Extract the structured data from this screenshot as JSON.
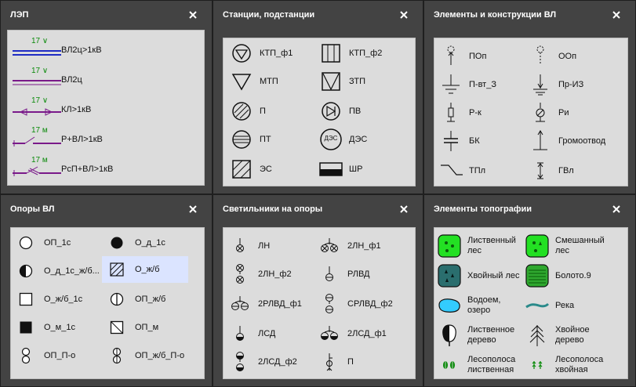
{
  "panels": {
    "lep": {
      "title": "ЛЭП",
      "items": [
        {
          "label": "ВЛ2ц>1кВ",
          "top_label": "17 ∨"
        },
        {
          "label": "ВЛ2ц",
          "top_label": "17 ∨"
        },
        {
          "label": "КЛ>1кВ",
          "top_label": "17 ∨"
        },
        {
          "label": "Р+ВЛ>1кВ",
          "top_label": "17 м"
        },
        {
          "label": "РсП+ВЛ>1кВ",
          "top_label": "17 м"
        }
      ]
    },
    "stations": {
      "title": "Станции, подстанции",
      "items": [
        {
          "label": "КТП_ф1"
        },
        {
          "label": "КТП_ф2"
        },
        {
          "label": "МТП"
        },
        {
          "label": "ЗТП"
        },
        {
          "label": "П"
        },
        {
          "label": "ПВ"
        },
        {
          "label": "ПТ"
        },
        {
          "label": "ДЭС",
          "icon_text": "ДЭС"
        },
        {
          "label": "ЭС"
        },
        {
          "label": "ШР"
        }
      ]
    },
    "elements": {
      "title": "Элементы и конструкции ВЛ",
      "items": [
        {
          "label": "ПОп"
        },
        {
          "label": "ООп"
        },
        {
          "label": "П-вт_З"
        },
        {
          "label": "Пр-ИЗ"
        },
        {
          "label": "Р-к"
        },
        {
          "label": "Ри"
        },
        {
          "label": "БК"
        },
        {
          "label": "Громоотвод"
        },
        {
          "label": "ТПл"
        },
        {
          "label": "ГВл"
        }
      ]
    },
    "supports": {
      "title": "Опоры ВЛ",
      "items": [
        {
          "label": "ОП_1с"
        },
        {
          "label": "О_д_1с"
        },
        {
          "label": "О_д_1с_ж/б..."
        },
        {
          "label": "О_ж/б"
        },
        {
          "label": "О_ж/б_1с"
        },
        {
          "label": "ОП_ж/б"
        },
        {
          "label": "О_м_1с"
        },
        {
          "label": "ОП_м"
        },
        {
          "label": "ОП_П-о"
        },
        {
          "label": "ОП_ж/б_П-о"
        }
      ]
    },
    "lights": {
      "title": "Светильники на опоры",
      "items": [
        {
          "label": "ЛН"
        },
        {
          "label": "2ЛН_ф1"
        },
        {
          "label": "2ЛН_ф2"
        },
        {
          "label": "РЛВД"
        },
        {
          "label": "2РЛВД_ф1"
        },
        {
          "label": "СРЛВД_ф2"
        },
        {
          "label": "ЛСД"
        },
        {
          "label": "2ЛСД_ф1"
        },
        {
          "label": "2ЛСД_ф2"
        },
        {
          "label": "П"
        }
      ]
    },
    "topo": {
      "title": "Элементы топографии",
      "items": [
        {
          "line1": "Лиственный",
          "line2": "лес"
        },
        {
          "line1": "Смешанный",
          "line2": "лес"
        },
        {
          "line1": "Хвойный лес",
          "line2": ""
        },
        {
          "line1": "Болото.9",
          "line2": ""
        },
        {
          "line1": "Водоем,",
          "line2": "озеро"
        },
        {
          "line1": "Река",
          "line2": ""
        },
        {
          "line1": "Лиственное",
          "line2": "дерево"
        },
        {
          "line1": "Хвойное",
          "line2": "дерево"
        },
        {
          "line1": "Лесополоса",
          "line2": "лиственная"
        },
        {
          "line1": "Лесополоса",
          "line2": "хвойная"
        }
      ]
    }
  },
  "colors": {
    "panel_bg": "#434343",
    "content_bg": "#dcdcdc",
    "selected_bg": "#dbe4ff",
    "line_blue": "#1f2cc4",
    "line_purple": "#7a1a8a",
    "label_green": "#0a8a0a",
    "forest_green": "#23e023",
    "conifer_teal": "#2a6e6e",
    "water_cyan": "#33ccff",
    "river_teal": "#2a8a8a"
  },
  "selected_item": "О_ж/б"
}
